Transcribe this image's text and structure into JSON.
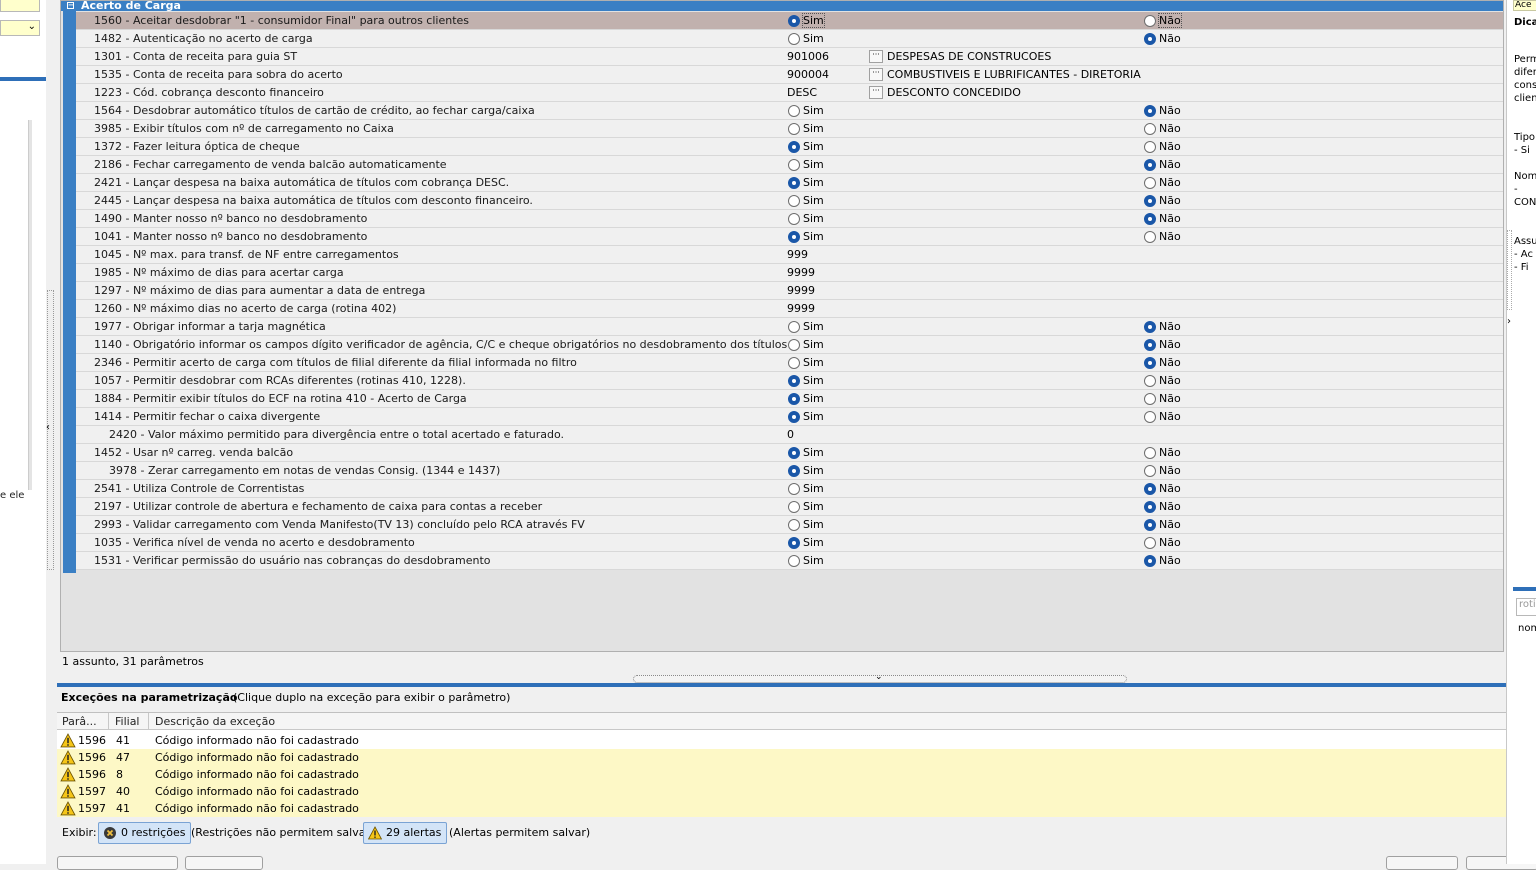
{
  "left_panel": {
    "partial_text": "e ele",
    "dropdown_icon": "chevron-down-icon"
  },
  "group": {
    "title": "Acerto de Carga",
    "toggle": "−"
  },
  "parameters": [
    {
      "label": "1560 - Aceitar desdobrar \"1 - consumidor Final\" para outros clientes",
      "kind": "radio",
      "value": "sim",
      "selected": true
    },
    {
      "label": "1482 - Autenticação no acerto de carga",
      "kind": "radio",
      "value": "nao"
    },
    {
      "label": "1301 - Conta de receita para guia ST",
      "kind": "lookup",
      "code": "901006",
      "desc": "DESPESAS DE CONSTRUCOES"
    },
    {
      "label": "1535 - Conta de receita para sobra do acerto",
      "kind": "lookup",
      "code": "900004",
      "desc": "COMBUSTIVEIS E LUBRIFICANTES - DIRETORIA"
    },
    {
      "label": "1223 - Cód. cobrança desconto financeiro",
      "kind": "lookup",
      "code": "DESC",
      "desc": "DESCONTO CONCEDIDO"
    },
    {
      "label": "1564 - Desdobrar automático títulos de cartão de crédito, ao fechar carga/caixa",
      "kind": "radio",
      "value": "nao"
    },
    {
      "label": "3985 - Exibir títulos com nº de carregamento no Caixa",
      "kind": "radio",
      "value": "none"
    },
    {
      "label": "1372 - Fazer leitura óptica de cheque",
      "kind": "radio",
      "value": "sim"
    },
    {
      "label": "2186 - Fechar carregamento de venda balcão automaticamente",
      "kind": "radio",
      "value": "nao"
    },
    {
      "label": "2421 - Lançar despesa na baixa automática de títulos com cobrança DESC.",
      "kind": "radio",
      "value": "sim"
    },
    {
      "label": "2445 - Lançar despesa na baixa automática de títulos com desconto financeiro.",
      "kind": "radio",
      "value": "nao"
    },
    {
      "label": "1490 - Manter nosso nº banco no desdobramento",
      "kind": "radio",
      "value": "nao"
    },
    {
      "label": "1041 - Manter nosso nº banco no desdobramento",
      "kind": "radio",
      "value": "sim"
    },
    {
      "label": "1045 - Nº max. para transf. de NF entre carregamentos",
      "kind": "value",
      "value": "999"
    },
    {
      "label": "1985 - Nº máximo de dias para acertar carga",
      "kind": "value",
      "value": "9999"
    },
    {
      "label": "1297 - Nº máximo de dias para aumentar a data de entrega",
      "kind": "value",
      "value": "9999"
    },
    {
      "label": "1260 - Nº máximo dias no acerto de carga (rotina 402)",
      "kind": "value",
      "value": "9999"
    },
    {
      "label": "1977 - Obrigar informar a tarja magnética",
      "kind": "radio",
      "value": "nao"
    },
    {
      "label": "1140 - Obrigatório informar os campos dígito verificador de agência, C/C e cheque obrigatórios no desdobramento dos títulos",
      "kind": "radio",
      "value": "nao"
    },
    {
      "label": "2346 - Permitir acerto de carga com títulos de filial diferente da filial informada no filtro",
      "kind": "radio",
      "value": "nao"
    },
    {
      "label": "1057 - Permitir desdobrar com RCAs diferentes (rotinas 410, 1228).",
      "kind": "radio",
      "value": "sim"
    },
    {
      "label": "1884 - Permitir exibir títulos do ECF na rotina 410 - Acerto de Carga",
      "kind": "radio",
      "value": "sim"
    },
    {
      "label": "1414 - Permitir fechar o caixa divergente",
      "kind": "radio",
      "value": "sim"
    },
    {
      "label": "2420 - Valor máximo permitido para divergência entre o total acertado e faturado.",
      "kind": "value",
      "value": "0",
      "sub": true
    },
    {
      "label": "1452 - Usar nº carreg. venda balcão",
      "kind": "radio",
      "value": "sim"
    },
    {
      "label": "3978 - Zerar carregamento em notas de vendas Consig. (1344 e 1437)",
      "kind": "radio",
      "value": "sim",
      "sub": true
    },
    {
      "label": "2541 - Utiliza Controle de Correntistas",
      "kind": "radio",
      "value": "nao"
    },
    {
      "label": "2197 - Utilizar controle de abertura e fechamento de caixa para contas a receber",
      "kind": "radio",
      "value": "nao"
    },
    {
      "label": "2993 - Validar carregamento com Venda Manifesto(TV 13) concluído pelo RCA através FV",
      "kind": "radio",
      "value": "nao"
    },
    {
      "label": "1035 - Verifica nível de venda no acerto e desdobramento",
      "kind": "radio",
      "value": "sim"
    },
    {
      "label": "1531 - Verificar permissão do usuário nas cobranças do desdobramento",
      "kind": "radio",
      "value": "nao"
    }
  ],
  "labels": {
    "sim": "Sim",
    "nao": "Não",
    "lookup_button": "···"
  },
  "summary": "1 assunto, 31 parâmetros",
  "exceptions": {
    "title": "Exceções na parametrização",
    "hint": "(Clique duplo na exceção para exibir o parâmetro)",
    "columns": [
      "Parâ...",
      "Filial",
      "Descrição da exceção"
    ],
    "rows": [
      {
        "param": "1596",
        "filial": "41",
        "desc": "Código informado não foi cadastrado"
      },
      {
        "param": "1596",
        "filial": "47",
        "desc": "Código informado não foi cadastrado"
      },
      {
        "param": "1596",
        "filial": "8",
        "desc": "Código informado não foi cadastrado"
      },
      {
        "param": "1597",
        "filial": "40",
        "desc": "Código informado não foi cadastrado"
      },
      {
        "param": "1597",
        "filial": "41",
        "desc": "Código informado não foi cadastrado"
      }
    ]
  },
  "footer": {
    "show_label": "Exibir:",
    "restrictions_button": "0 restrições",
    "restrictions_note": "(Restrições não permitem salvar)",
    "alerts_button": "29 alertas",
    "alerts_note": "(Alertas permitem salvar)"
  },
  "right_panel": {
    "tab": "Ace",
    "title": "Dica",
    "lines": [
      "Perm",
      "difer",
      "cons",
      "clien",
      "",
      "Tipo",
      " - Si",
      "",
      "Nome",
      " -",
      "CON",
      "",
      "",
      "Assu",
      " - Ac",
      " - Fi"
    ],
    "search_placeholder": "roti",
    "bottom_text": "nom"
  },
  "colors": {
    "accent": "#3a7fc4",
    "selected_row": "#c1b1ae",
    "alert_row": "#fdf8c6",
    "radio_on": "#1a57a8"
  }
}
